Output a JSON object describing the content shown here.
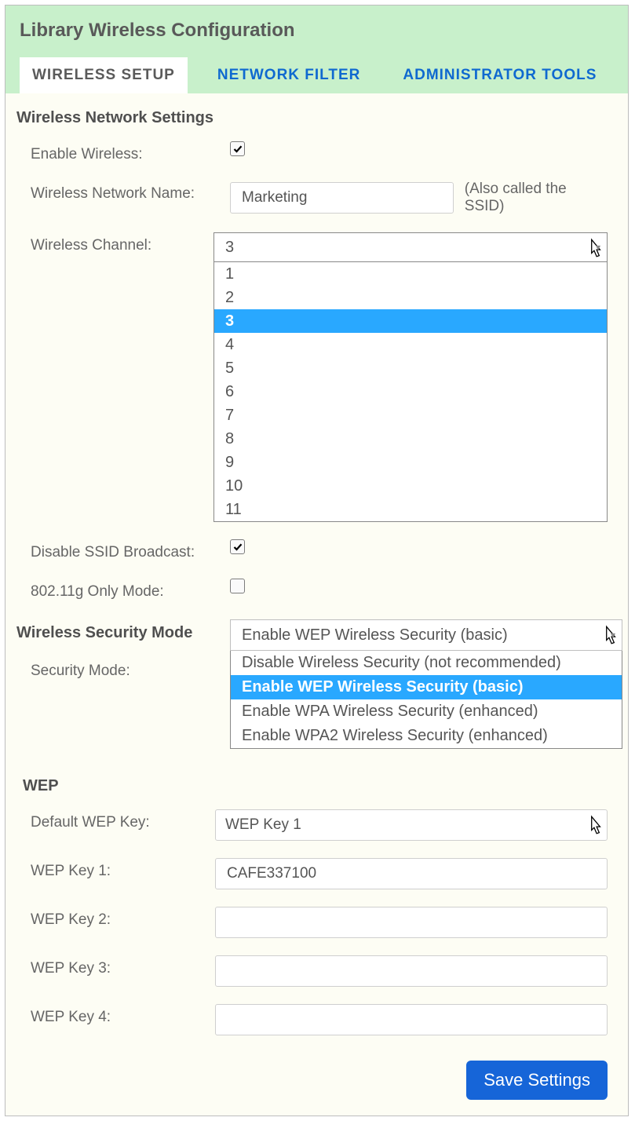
{
  "title": "Library Wireless Configuration",
  "tabs": [
    {
      "label": "WIRELESS SETUP",
      "active": true
    },
    {
      "label": "NETWORK FILTER",
      "active": false
    },
    {
      "label": "ADMINISTRATOR TOOLS",
      "active": false
    }
  ],
  "sections": {
    "network": {
      "heading": "Wireless Network Settings",
      "enable_label": "Enable Wireless:",
      "enable_checked": true,
      "name_label": "Wireless Network Name:",
      "name_value": "Marketing",
      "name_hint": "(Also called the SSID)",
      "channel_label": "Wireless Channel:",
      "channel_selected": "3",
      "channel_options": [
        "1",
        "2",
        "3",
        "4",
        "5",
        "6",
        "7",
        "8",
        "9",
        "10",
        "11"
      ],
      "disable_ssid_label": "Disable SSID Broadcast:",
      "disable_ssid_checked": true,
      "gonly_label": "802.11g Only Mode:",
      "gonly_checked": false
    },
    "security": {
      "heading": "Wireless Security Mode",
      "mode_label": "Security Mode:",
      "mode_selected": "Enable WEP Wireless Security (basic)",
      "mode_options": [
        "Disable Wireless Security (not recommended)",
        "Enable WEP Wireless Security (basic)",
        "Enable WPA Wireless Security (enhanced)",
        "Enable WPA2 Wireless Security (enhanced)"
      ]
    },
    "wep": {
      "heading": "WEP",
      "default_key_label": "Default WEP Key:",
      "default_key_value": "WEP Key 1",
      "key1_label": "WEP Key 1:",
      "key1_value": "CAFE337100",
      "key2_label": "WEP Key 2:",
      "key2_value": "",
      "key3_label": "WEP Key 3:",
      "key3_value": "",
      "key4_label": "WEP Key 4:",
      "key4_value": ""
    }
  },
  "save_button": "Save Settings"
}
